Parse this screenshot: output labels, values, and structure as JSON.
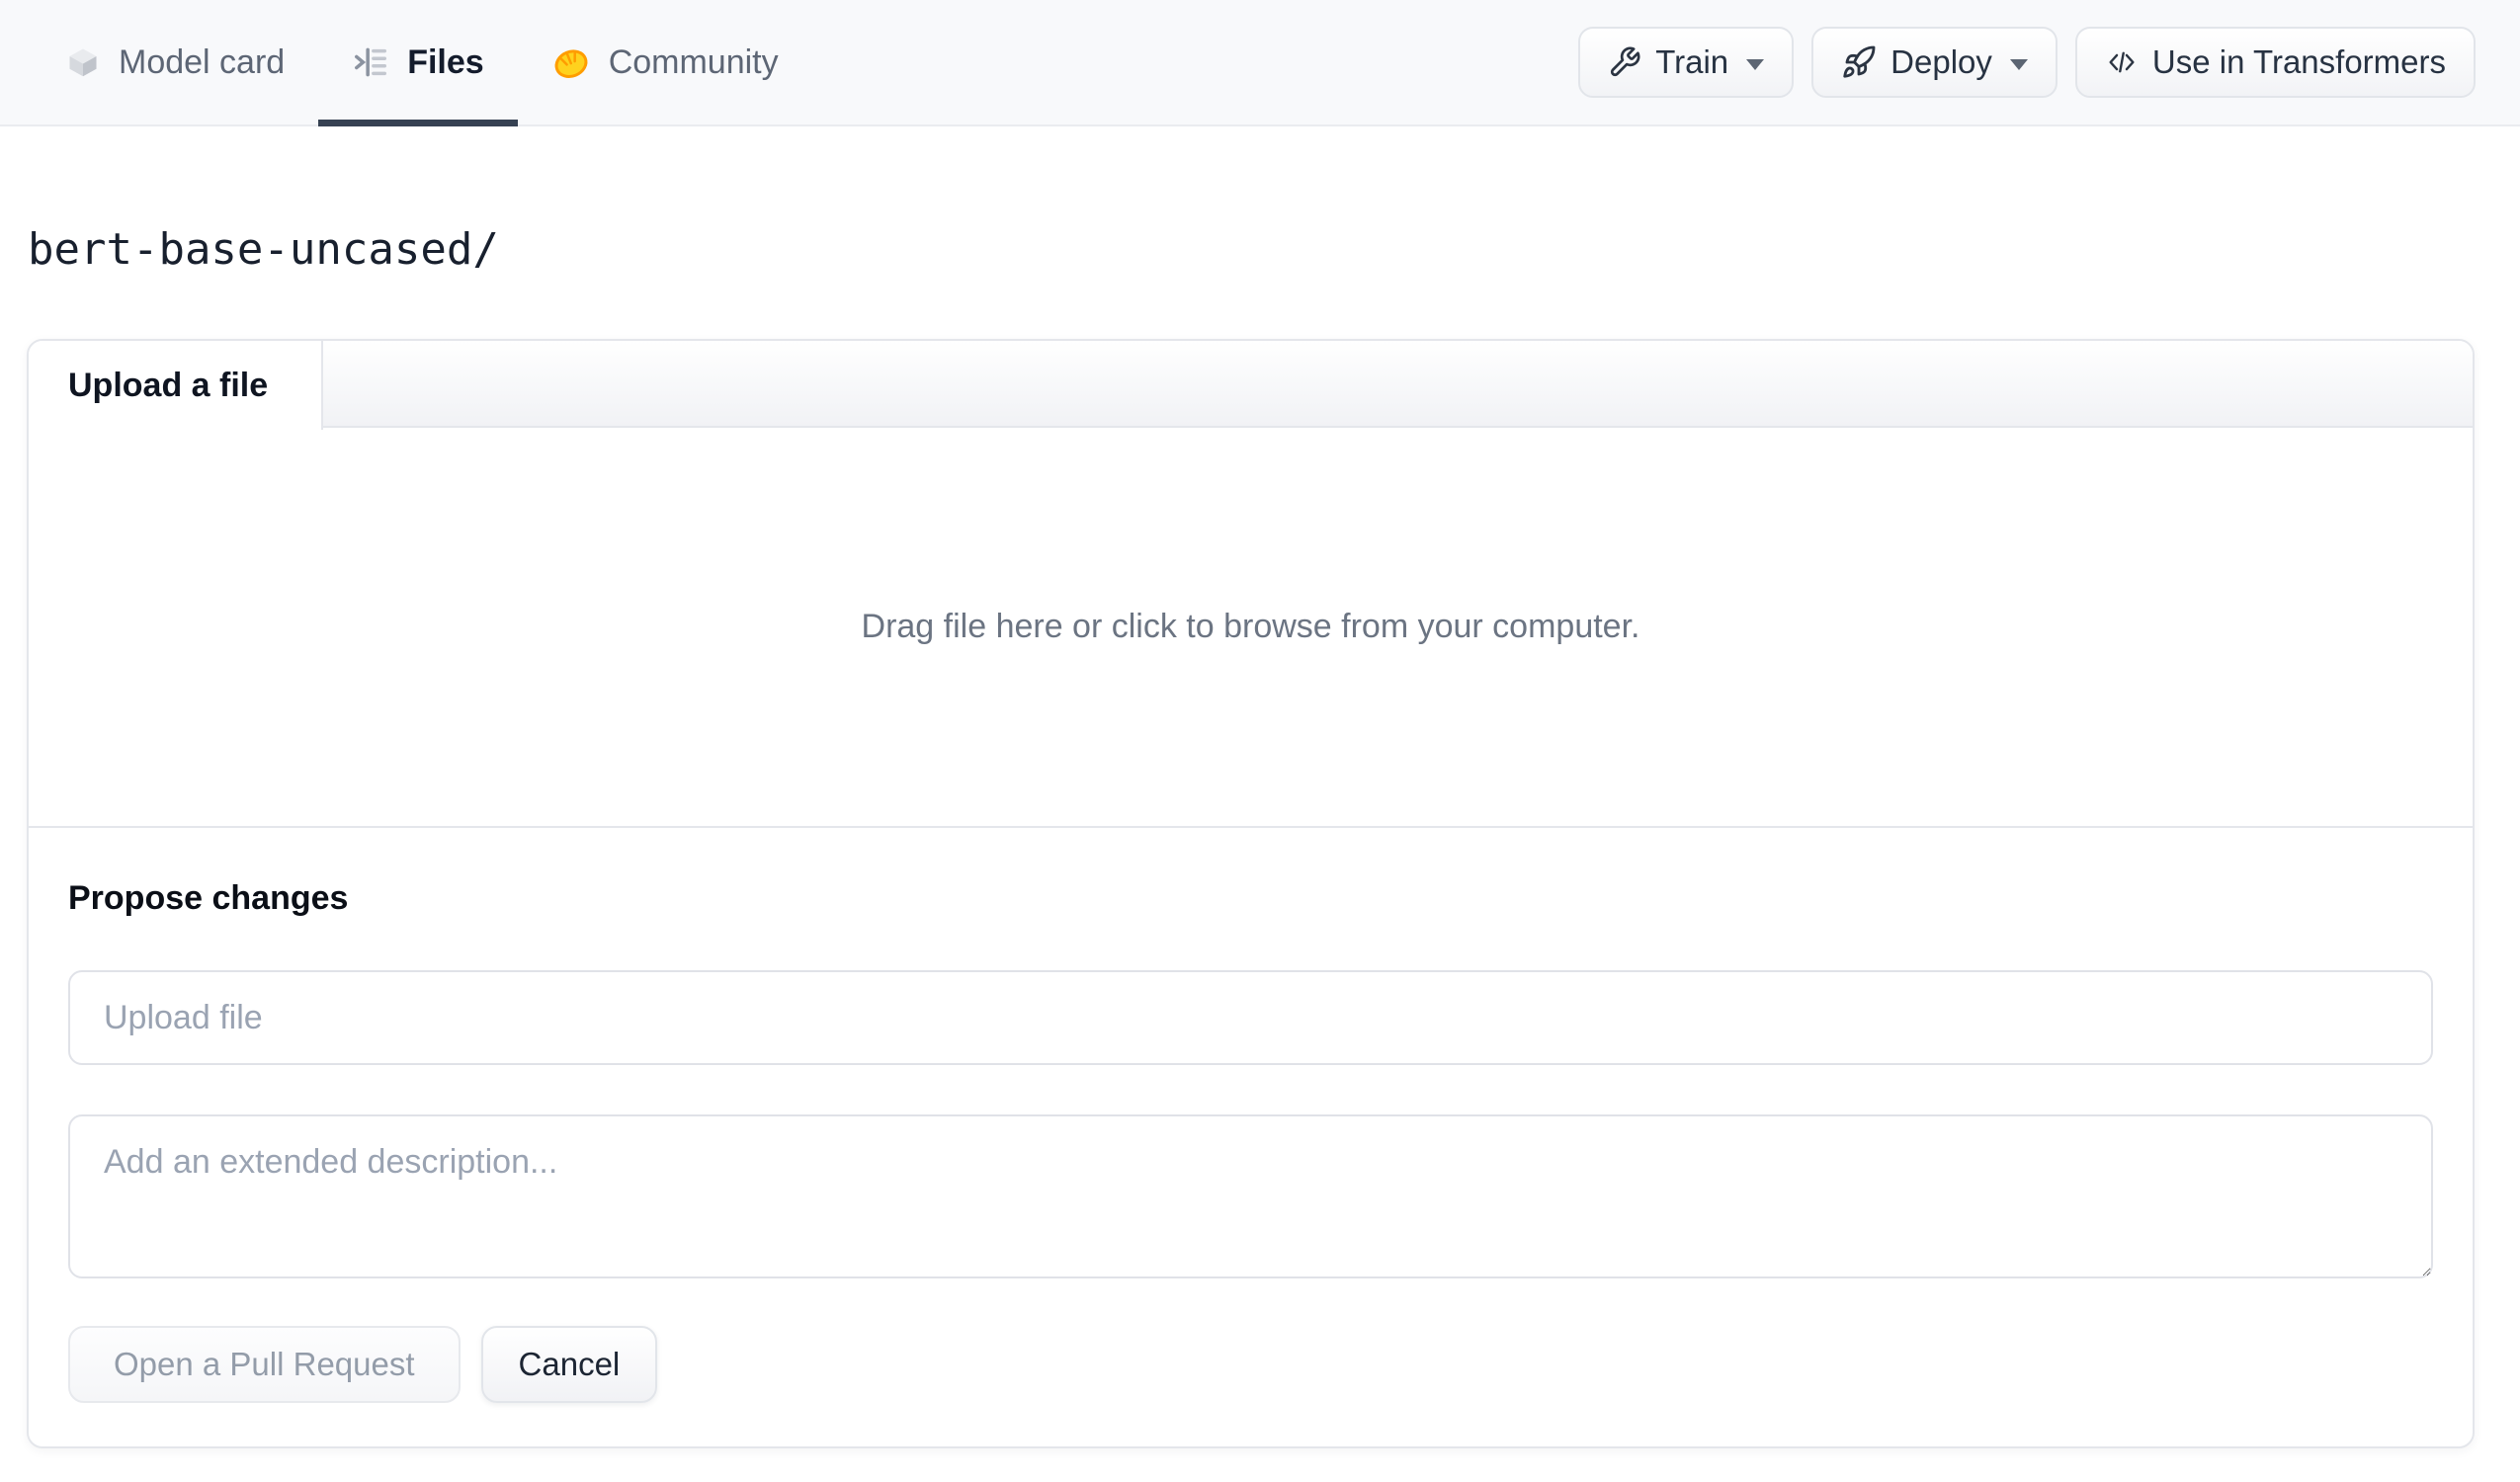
{
  "repo": {
    "title": "bert-base-uncased/"
  },
  "nav": {
    "tabs": [
      {
        "label": "Model card",
        "icon": "cube-icon",
        "active": false
      },
      {
        "label": "Files",
        "icon": "versions-icon",
        "active": true
      },
      {
        "label": "Community",
        "icon": "waving-hand-icon",
        "active": false
      }
    ],
    "actions": [
      {
        "label": "Train",
        "icon": "wrench-icon",
        "has_caret": true
      },
      {
        "label": "Deploy",
        "icon": "rocket-icon",
        "has_caret": true
      },
      {
        "label": "Use in Transformers",
        "icon": "code-icon",
        "has_caret": false
      }
    ]
  },
  "upload_card": {
    "tab_label": "Upload a file",
    "dropzone_text": "Drag file here or click to browse from your computer.",
    "propose": {
      "heading": "Propose changes",
      "file_input_placeholder": "Upload file",
      "description_placeholder": "Add an extended description...",
      "submit_label": "Open a Pull Request",
      "cancel_label": "Cancel"
    }
  },
  "colors": {
    "topbar-bg": "#f8f9fb",
    "border": "#e5e7eb",
    "active-tab-underline": "#364152",
    "tab-text": "#5d6675",
    "tab-text-active": "#141c2c",
    "muted-text": "#6b7482",
    "placeholder": "#9aa3b2",
    "button-text": "#273242",
    "disabled-text": "#939ca9",
    "hand-yellow": "#ffd21e",
    "hand-orange": "#ff9d00"
  }
}
